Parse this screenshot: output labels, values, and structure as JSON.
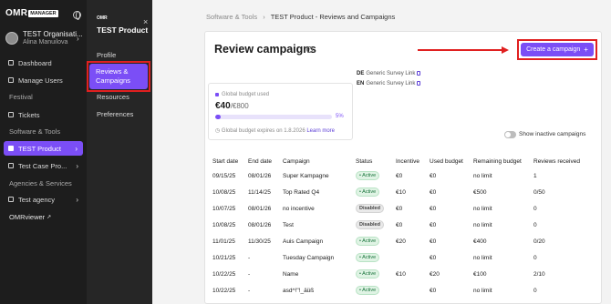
{
  "sidebar": {
    "logo": "OMR",
    "logo_tag": "MANAGER",
    "org_name": "TEST Organisati...",
    "org_user": "Alina Manuilova",
    "items": [
      {
        "label": "Dashboard",
        "kind": "link"
      },
      {
        "label": "Manage Users",
        "kind": "link"
      },
      {
        "label": "Festival",
        "kind": "section"
      },
      {
        "label": "Tickets",
        "kind": "link"
      },
      {
        "label": "Software & Tools",
        "kind": "section"
      },
      {
        "label": "TEST Product",
        "kind": "active"
      },
      {
        "label": "Test Case Pro...",
        "kind": "link"
      },
      {
        "label": "Agencies & Services",
        "kind": "section"
      },
      {
        "label": "Test agency",
        "kind": "link"
      },
      {
        "label": "OMRviewer",
        "kind": "link"
      }
    ]
  },
  "subpanel": {
    "logo": "OMR",
    "title": "TEST Product",
    "items": [
      "Profile",
      "Reviews & Campaigns",
      "Resources",
      "Preferences"
    ],
    "close": "×"
  },
  "breadcrumb": {
    "root": "Software & Tools",
    "sep": "›",
    "current": "TEST Product - Reviews and Campaigns"
  },
  "main": {
    "title": "Review campaigns",
    "create_button": "Create a campaign",
    "budget": {
      "label": "Global budget used",
      "used": "€40",
      "total": "/€800",
      "percent": 5,
      "percent_label": "5%",
      "expiry": "Global budget expires on 1.8.2026",
      "learn_more": "Learn more"
    },
    "survey_links": [
      {
        "lang": "DE",
        "label": "Generic Survey Link"
      },
      {
        "lang": "EN",
        "label": "Generic Survey Link"
      }
    ],
    "toggle_label": "Show inactive campaigns",
    "table": {
      "headers": [
        "Start date",
        "End date",
        "Campaign",
        "Status",
        "Incentive",
        "Used budget",
        "Remaining budget",
        "Reviews received"
      ],
      "rows": [
        [
          "09/15/25",
          "08/01/26",
          "Super Kampagne",
          "Active",
          "€0",
          "€0",
          "no limit",
          "1"
        ],
        [
          "10/08/25",
          "11/14/25",
          "Top Rated Q4",
          "Active",
          "€10",
          "€0",
          "€500",
          "0/50"
        ],
        [
          "10/07/25",
          "08/01/26",
          "no incentive",
          "Disabled",
          "€0",
          "€0",
          "no limit",
          "0"
        ],
        [
          "10/08/25",
          "08/01/26",
          "Test",
          "Disabled",
          "€0",
          "€0",
          "no limit",
          "0"
        ],
        [
          "11/01/25",
          "11/30/25",
          "Auis Campaign",
          "Active",
          "€20",
          "€0",
          "€400",
          "0/20"
        ],
        [
          "10/21/25",
          "-",
          "Tuesday Campaign",
          "Active",
          "",
          "€0",
          "no limit",
          "0"
        ],
        [
          "10/22/25",
          "-",
          "Name",
          "Active",
          "€10",
          "€20",
          "€100",
          "2/10"
        ],
        [
          "10/22/25",
          "-",
          "asd^!\"!_äüß",
          "Active",
          "",
          "€0",
          "no limit",
          "0"
        ]
      ]
    }
  },
  "colors": {
    "accent": "#7b4ef6",
    "annotation": "#e02020",
    "active_badge": "#17733a"
  }
}
